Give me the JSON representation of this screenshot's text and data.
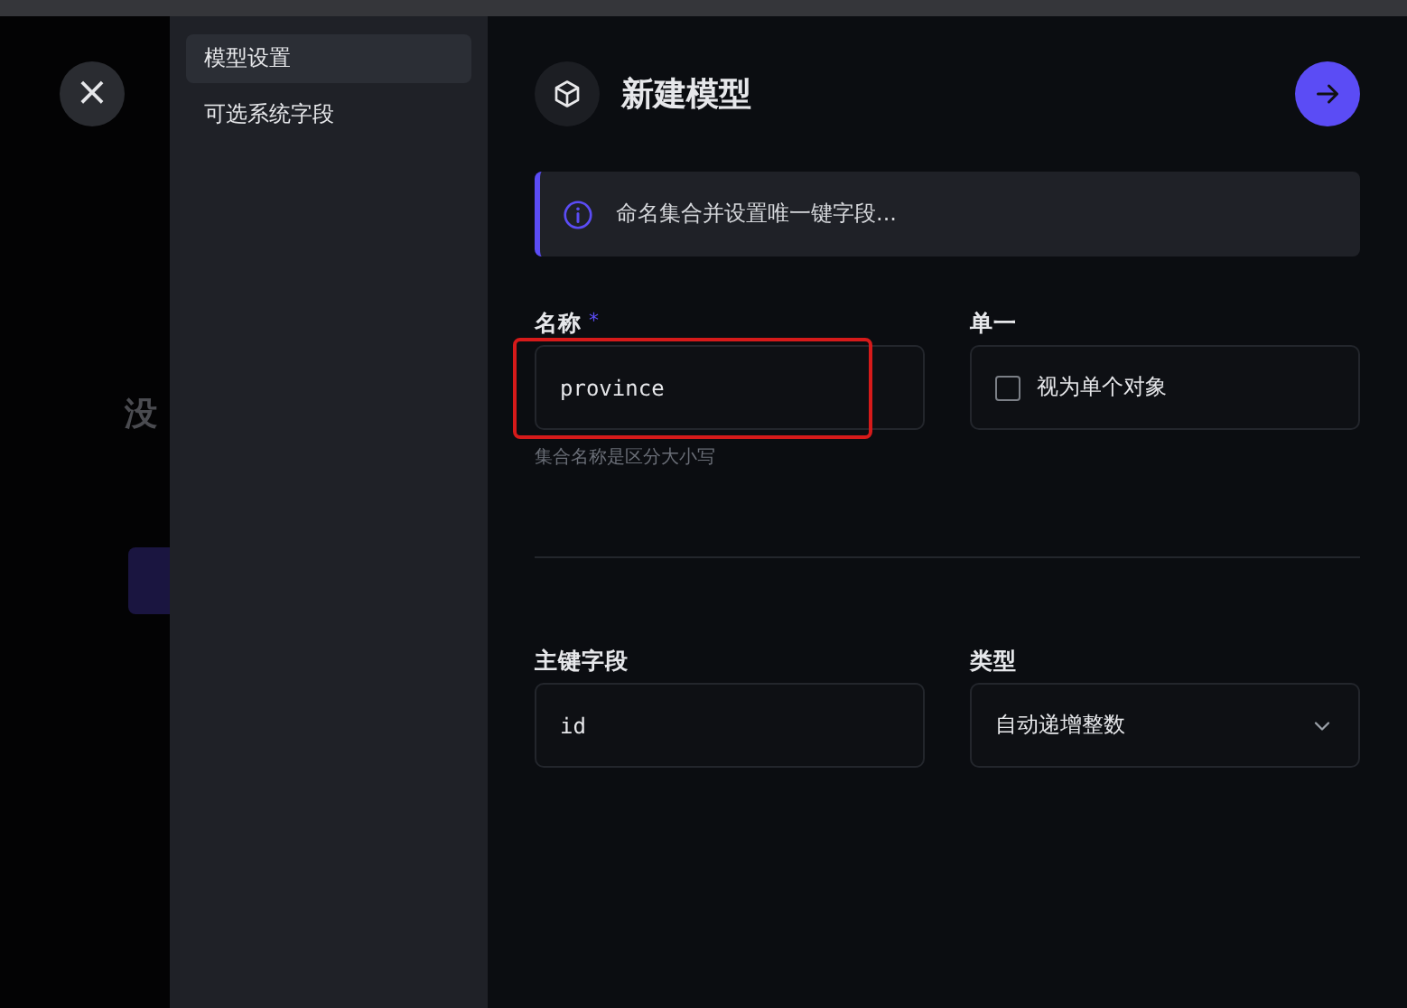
{
  "backdrop": {
    "close_label": "×",
    "heading": "没"
  },
  "sidebar": {
    "items": [
      {
        "label": "模型设置",
        "selected": true
      },
      {
        "label": "可选系统字段",
        "selected": false
      }
    ]
  },
  "header": {
    "title": "新建模型"
  },
  "notice": {
    "text": "命名集合并设置唯一键字段..."
  },
  "form": {
    "rows": [
      [
        {
          "kind": "text",
          "label": "名称",
          "required_mark": "*",
          "value": "province",
          "hint": "集合名称是区分大小写",
          "highlighted": true
        },
        {
          "kind": "checkbox",
          "label": "单一",
          "option": "视为单个对象",
          "checked": false
        }
      ],
      [
        {
          "kind": "text",
          "label": "主键字段",
          "value": "id"
        },
        {
          "kind": "select",
          "label": "类型",
          "value": "自动递增整数"
        }
      ]
    ]
  }
}
